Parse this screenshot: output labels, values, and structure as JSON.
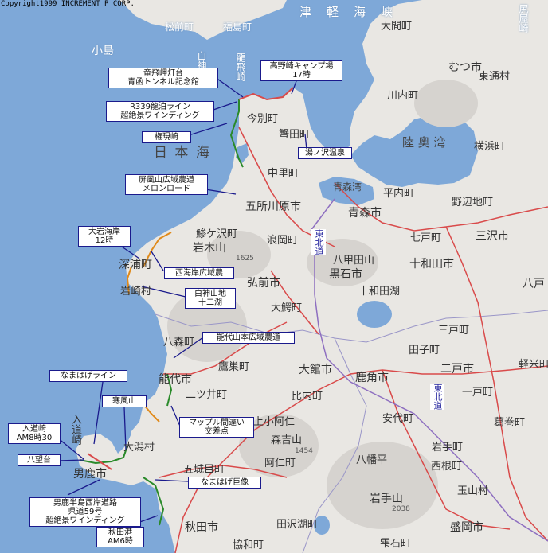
{
  "copyright": "Copyright1999 INCREMENT P CORP.",
  "sea_labels": [
    {
      "id": "nihonkai",
      "text": "日 本 海"
    },
    {
      "id": "tsugaru",
      "text": "津　軽　海　峡"
    },
    {
      "id": "mutsuwan",
      "text": "陸 奥 湾"
    },
    {
      "id": "aomoriwan",
      "text": "青森湾"
    }
  ],
  "places": [
    {
      "id": "matsumae",
      "text": "松前町"
    },
    {
      "id": "fukushima",
      "text": "福島町"
    },
    {
      "id": "kojima",
      "text": "小島"
    },
    {
      "id": "shirakami",
      "text": "白神岬"
    },
    {
      "id": "tappi",
      "text": "龍飛崎"
    },
    {
      "id": "oomamachi",
      "text": "大間町"
    },
    {
      "id": "shimokita",
      "text": "尻屋崎"
    },
    {
      "id": "mutsu",
      "text": "むつ市"
    },
    {
      "id": "higashidori",
      "text": "東通村"
    },
    {
      "id": "kawauchi",
      "text": "川内町"
    },
    {
      "id": "imabetsu",
      "text": "今別町"
    },
    {
      "id": "kanita",
      "text": "蟹田町"
    },
    {
      "id": "yokohama",
      "text": "横浜町"
    },
    {
      "id": "nakasato",
      "text": "中里町"
    },
    {
      "id": "goshogawara",
      "text": "五所川原市"
    },
    {
      "id": "aomori",
      "text": "青森市"
    },
    {
      "id": "hiranai",
      "text": "平内町"
    },
    {
      "id": "nohechi",
      "text": "野辺地町"
    },
    {
      "id": "misawa",
      "text": "三沢市"
    },
    {
      "id": "ajigasawa",
      "text": "鯵ケ沢町"
    },
    {
      "id": "iwaki",
      "text": "岩木山"
    },
    {
      "id": "iwaki_h",
      "text": "1625"
    },
    {
      "id": "namioka",
      "text": "浪岡町"
    },
    {
      "id": "shichinohe",
      "text": "七戸町"
    },
    {
      "id": "towada",
      "text": "十和田市"
    },
    {
      "id": "hakkoda",
      "text": "八甲田山"
    },
    {
      "id": "kuroishi",
      "text": "黒石市"
    },
    {
      "id": "fukaura",
      "text": "深浦町"
    },
    {
      "id": "iwasaki",
      "text": "岩崎村"
    },
    {
      "id": "hirosaki",
      "text": "弘前市"
    },
    {
      "id": "towadako",
      "text": "十和田湖"
    },
    {
      "id": "owani",
      "text": "大鰐町"
    },
    {
      "id": "hachinohe",
      "text": "八戸"
    },
    {
      "id": "sannohe",
      "text": "三戸町"
    },
    {
      "id": "taneichi",
      "text": "田子町"
    },
    {
      "id": "hachimori",
      "text": "八森町"
    },
    {
      "id": "takanosu",
      "text": "鷹巣町"
    },
    {
      "id": "odate",
      "text": "大館市"
    },
    {
      "id": "kazuno",
      "text": "鹿角市"
    },
    {
      "id": "ninohe",
      "text": "二戸市"
    },
    {
      "id": "karumai",
      "text": "軽米町"
    },
    {
      "id": "noshiro",
      "text": "能代市"
    },
    {
      "id": "futatsui",
      "text": "二ツ井町"
    },
    {
      "id": "hinai",
      "text": "比内町"
    },
    {
      "id": "ichinohe",
      "text": "一戸町"
    },
    {
      "id": "anshiro",
      "text": "安代町"
    },
    {
      "id": "kuzumaki",
      "text": "葛巻町"
    },
    {
      "id": "oga_hanto",
      "text": "入道崎"
    },
    {
      "id": "ogata",
      "text": "大潟村"
    },
    {
      "id": "kamikoani",
      "text": "上小阿仁"
    },
    {
      "id": "moriyoshi",
      "text": "森吉山"
    },
    {
      "id": "moriyoshi_h",
      "text": "1454"
    },
    {
      "id": "aniai",
      "text": "阿仁町"
    },
    {
      "id": "hachimantai",
      "text": "八幡平"
    },
    {
      "id": "iwate_ya",
      "text": "岩手町"
    },
    {
      "id": "nishine",
      "text": "西根町"
    },
    {
      "id": "tamayama",
      "text": "玉山村"
    },
    {
      "id": "gojome",
      "text": "五城目町"
    },
    {
      "id": "ogashi",
      "text": "男鹿市"
    },
    {
      "id": "akita",
      "text": "秋田市"
    },
    {
      "id": "tazawa",
      "text": "田沢湖町"
    },
    {
      "id": "iwatesan",
      "text": "岩手山"
    },
    {
      "id": "iwatesan_h",
      "text": "2038"
    },
    {
      "id": "morioka",
      "text": "盛岡市"
    },
    {
      "id": "shizukuishi",
      "text": "雫石町"
    },
    {
      "id": "kyowa",
      "text": "協和町"
    }
  ],
  "routes": [
    {
      "id": "r4",
      "text": "東北道"
    },
    {
      "id": "r7",
      "text": "東北道"
    }
  ],
  "callouts": [
    {
      "id": "c1",
      "lines": [
        "竜飛岬灯台",
        "青函トンネル記念館"
      ]
    },
    {
      "id": "c2",
      "lines": [
        "高野崎キャンプ場",
        "17時"
      ]
    },
    {
      "id": "c3",
      "lines": [
        "R339龍泊ライン",
        "超絶景ワインディング"
      ]
    },
    {
      "id": "c4",
      "lines": [
        "権現崎"
      ]
    },
    {
      "id": "c5",
      "lines": [
        "湯ノ沢温泉"
      ]
    },
    {
      "id": "c6",
      "lines": [
        "屏風山広域農道",
        "メロンロード"
      ]
    },
    {
      "id": "c7",
      "lines": [
        "大岩海岸",
        "12時"
      ]
    },
    {
      "id": "c8",
      "lines": [
        "西海岸広域農"
      ]
    },
    {
      "id": "c9",
      "lines": [
        "白神山地",
        "十二湖"
      ]
    },
    {
      "id": "c10",
      "lines": [
        "能代山本広域農道"
      ]
    },
    {
      "id": "c11",
      "lines": [
        "なまはげライン"
      ]
    },
    {
      "id": "c12",
      "lines": [
        "寒風山"
      ]
    },
    {
      "id": "c13",
      "lines": [
        "入道崎",
        "AM8時30"
      ]
    },
    {
      "id": "c14",
      "lines": [
        "八望台"
      ]
    },
    {
      "id": "c15",
      "lines": [
        "マップル間違い",
        "交差点"
      ]
    },
    {
      "id": "c16",
      "lines": [
        "なまはげ巨像"
      ]
    },
    {
      "id": "c17",
      "lines": [
        "男鹿半島西岸道路",
        "県道59号",
        "超絶景ワインディング"
      ]
    },
    {
      "id": "c18",
      "lines": [
        "秋田港",
        "AM6時"
      ]
    }
  ],
  "colors": {
    "sea": "#7ea8d8",
    "land": "#e9e7e3",
    "mountain": "#d6d3cf",
    "road_red": "#d94a4a",
    "road_purple": "#8e6fc0",
    "route_green": "#2a8a2a",
    "route_orange": "#e08a1a",
    "callout_border": "#1a1a8c"
  }
}
